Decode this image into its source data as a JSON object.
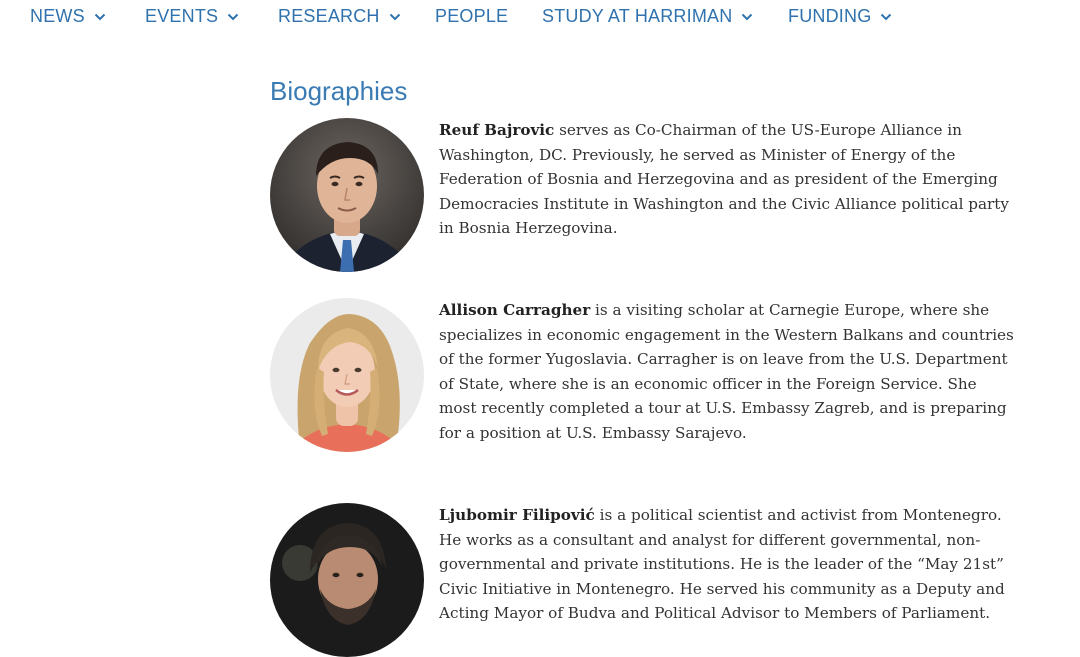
{
  "nav": {
    "items": [
      {
        "label": "NEWS",
        "has_dropdown": true
      },
      {
        "label": "EVENTS",
        "has_dropdown": true
      },
      {
        "label": "RESEARCH",
        "has_dropdown": true
      },
      {
        "label": "PEOPLE",
        "has_dropdown": false
      },
      {
        "label": "STUDY AT HARRIMAN",
        "has_dropdown": true
      },
      {
        "label": "FUNDING",
        "has_dropdown": true
      }
    ],
    "color": "#2f72ad"
  },
  "section": {
    "title": "Biographies",
    "title_color": "#3a7bb4"
  },
  "bios": [
    {
      "name": "Reuf Bajrovic",
      "text": " serves as Co-Chairman of the US-Europe Alliance in Washington, DC. Previously, he served as Minister of Energy of the Federation of Bosnia and Herzegovina and as president of the Emerging Democracies Institute in Washington and the Civic Alliance political party in Bosnia Herzegovina."
    },
    {
      "name": "Allison Carragher",
      "text": " is a visiting scholar at Carnegie Europe, where she specializes in economic engagement in the Western Balkans and countries of the former Yugoslavia. Carragher is on leave from the U.S. Department of State, where she is an economic officer in the Foreign Service. She most recently completed a tour at U.S. Embassy Zagreb, and is preparing for a position at U.S. Embassy Sarajevo."
    },
    {
      "name": "Ljubomir Filipović",
      "text": " is a political scientist and activist from Montenegro. He works as a consultant and analyst for different governmental, non-governmental and private institutions. He is the leader of the “May 21st” Civic Initiative in Montenegro. He served his community as a Deputy and Acting Mayor of Budva and Political Advisor to Members of Parliament."
    }
  ]
}
